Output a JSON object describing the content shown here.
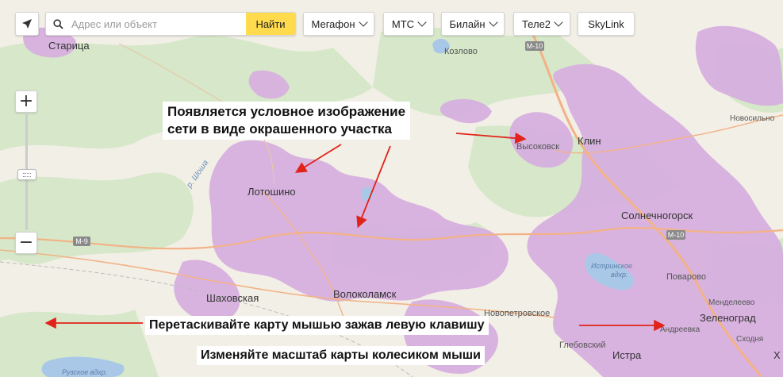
{
  "search": {
    "placeholder": "Адрес или объект",
    "button_label": "Найти"
  },
  "operators": [
    {
      "label": "Мегафон",
      "has_dropdown": true
    },
    {
      "label": "МТС",
      "has_dropdown": true
    },
    {
      "label": "Билайн",
      "has_dropdown": true
    },
    {
      "label": "Теле2",
      "has_dropdown": true
    },
    {
      "label": "SkyLink",
      "has_dropdown": false
    }
  ],
  "zoom": {
    "in_label": "+",
    "out_label": "−"
  },
  "annotations": {
    "coverage_line1": "Появляется условное изображение",
    "coverage_line2": "сети в виде окрашенного участка",
    "drag": "Перетаскивайте карту мышью зажав левую клавишу",
    "scroll": "Изменяйте масштаб карты колесиком мыши"
  },
  "map_labels": {
    "staritsa": "Старица",
    "kozlovo": "Козлово",
    "vysokovsk": "Высоковск",
    "klin": "Клин",
    "novoshino": "Новосильно",
    "shosha": "р. Шоша",
    "lotoshino": "Лотошино",
    "solnechnogorsk": "Солнечногорск",
    "m10_top": "М-10",
    "m10_mid": "М-10",
    "m9": "М-9",
    "istra_res": "Истринское",
    "istra_res2": "вдхр.",
    "povarovo": "Поварово",
    "shakhovskaya": "Шаховская",
    "volokolamsk": "Волоколамск",
    "novopetrovskoe": "Новопетровское",
    "mendeleevo": "Менделеево",
    "zelenograd": "Зеленоград",
    "andreevka": "Андреевка",
    "glebovsky": "Глебовский",
    "istra": "Истра",
    "skhodnya": "Сходня",
    "khimki": "Х",
    "ruzskoe": "Рузское вдхр."
  },
  "colors": {
    "coverage": "#d7aee0",
    "forest": "#d6e8c9",
    "land": "#f2efe6",
    "water": "#a9c8e8",
    "highway": "#f3b286",
    "arrow": "#e2231a",
    "search_button": "#ffdb4d"
  }
}
